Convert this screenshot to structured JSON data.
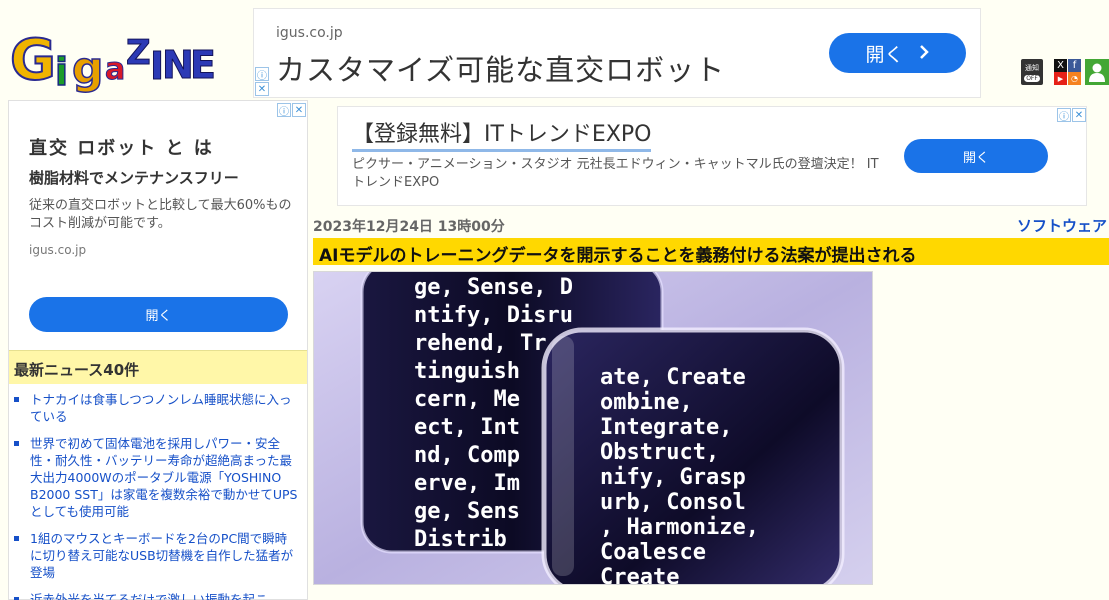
{
  "site": {
    "logo_text": "GigaZINE"
  },
  "top_ad": {
    "domain": "igus.co.jp",
    "headline": "カスタマイズ可能な直交ロボット",
    "button": "開く",
    "button_icon": "chevron-right-icon"
  },
  "header_icons": {
    "notify_label": "通知",
    "notify_state": "OFF"
  },
  "side_ad": {
    "title": "直交 ロボット と は",
    "subtitle": "樹脂材料でメンテナンスフリー",
    "body": "従来の直交ロボットと比較して最大60%ものコスト削減が可能です。",
    "domain": "igus.co.jp",
    "button": "開く"
  },
  "news": {
    "header": "最新ニュース40件",
    "items": [
      "トナカイは食事しつつノンレム睡眠状態に入っている",
      "世界で初めて固体電池を採用しパワー・安全性・耐久性・バッテリー寿命が超絶高まった最大出力4000Wのポータブル電源「YOSHINO B2000 SST」は家電を複数余裕で動かせてUPSとしても使用可能",
      "1組のマウスとキーボードを2台のPC間で瞬時に切り替え可能なUSB切替機を自作した猛者が登場",
      "近赤外光を当てるだけで激しい振動を起こ"
    ]
  },
  "main_ad": {
    "headline": "【登録無料】ITトレンドEXPO",
    "description": "ピクサー・アニメーション・スタジオ 元社長エドウィン・キャットマル氏の登壇決定！ ITトレンドEXPO",
    "button": "開く"
  },
  "article": {
    "date": "2023年12月24日 13時00分",
    "category": "ソフトウェア",
    "title": "AIモデルのトレーニングデータを開示することを義務付ける法案が提出される"
  },
  "image": {
    "words_left": [
      "ge, Sense, D",
      "ntify, Disru",
      "rehend, Tr",
      "tinguish",
      "cern, Me",
      "ect, Int",
      "nd, Comp",
      "erve, Im",
      "ge, Sens",
      "Distrib"
    ],
    "words_right": [
      "ate, Create",
      "ombine,",
      "Integrate,",
      "Obstruct,",
      "nify, Grasp",
      "urb, Consol",
      ", Harmonize,",
      "Coalesce",
      "Create"
    ],
    "colors": {
      "bg": "#c8c3e8",
      "glyph": "#ffffff",
      "dark": "#0c0a24"
    }
  }
}
